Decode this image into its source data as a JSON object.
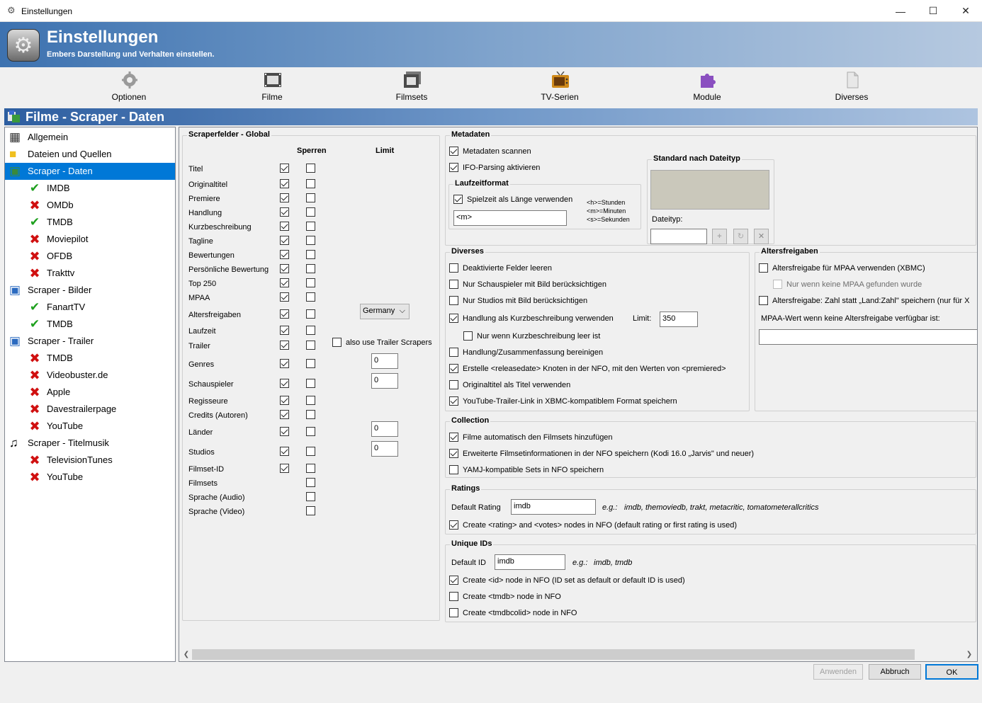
{
  "window": {
    "title": "Einstellungen",
    "minimize": "—",
    "maximize": "☐",
    "close": "✕"
  },
  "header": {
    "title": "Einstellungen",
    "subtitle": "Embers Darstellung und Verhalten einstellen."
  },
  "toolbar": [
    {
      "label": "Optionen",
      "icon": "gear-icon"
    },
    {
      "label": "Filme",
      "icon": "film-icon"
    },
    {
      "label": "Filmsets",
      "icon": "filmsets-icon"
    },
    {
      "label": "TV-Serien",
      "icon": "tv-icon"
    },
    {
      "label": "Module",
      "icon": "puzzle-icon"
    },
    {
      "label": "Diverses",
      "icon": "document-icon"
    }
  ],
  "section": {
    "title": "Filme - Scraper - Daten"
  },
  "tree": [
    {
      "label": "Allgemein",
      "level": 0,
      "icon": "film-icon"
    },
    {
      "label": "Dateien und Quellen",
      "level": 0,
      "icon": "folder-icon"
    },
    {
      "label": "Scraper - Daten",
      "level": 0,
      "icon": "scraper-data-icon",
      "selected": true
    },
    {
      "label": "IMDB",
      "level": 1,
      "icon": "check-icon"
    },
    {
      "label": "OMDb",
      "level": 1,
      "icon": "cross-icon"
    },
    {
      "label": "TMDB",
      "level": 1,
      "icon": "check-icon"
    },
    {
      "label": "Moviepilot",
      "level": 1,
      "icon": "cross-icon"
    },
    {
      "label": "OFDB",
      "level": 1,
      "icon": "cross-icon"
    },
    {
      "label": "Trakttv",
      "level": 1,
      "icon": "cross-icon"
    },
    {
      "label": "Scraper - Bilder",
      "level": 0,
      "icon": "scraper-images-icon"
    },
    {
      "label": "FanartTV",
      "level": 1,
      "icon": "check-icon"
    },
    {
      "label": "TMDB",
      "level": 1,
      "icon": "check-icon"
    },
    {
      "label": "Scraper - Trailer",
      "level": 0,
      "icon": "scraper-trailer-icon"
    },
    {
      "label": "TMDB",
      "level": 1,
      "icon": "cross-icon"
    },
    {
      "label": "Videobuster.de",
      "level": 1,
      "icon": "cross-icon"
    },
    {
      "label": "Apple",
      "level": 1,
      "icon": "cross-icon"
    },
    {
      "label": "Davestrailerpage",
      "level": 1,
      "icon": "cross-icon"
    },
    {
      "label": "YouTube",
      "level": 1,
      "icon": "cross-icon"
    },
    {
      "label": "Scraper - Titelmusik",
      "level": 0,
      "icon": "music-note-icon"
    },
    {
      "label": "TelevisionTunes",
      "level": 1,
      "icon": "cross-icon"
    },
    {
      "label": "YouTube",
      "level": 1,
      "icon": "cross-icon"
    }
  ],
  "scraperfields": {
    "title": "Scraperfelder - Global",
    "col_lock": "Sperren",
    "col_limit": "Limit",
    "rows": [
      {
        "label": "Titel",
        "enabled": true,
        "lock": false
      },
      {
        "label": "Originaltitel",
        "enabled": true,
        "lock": false
      },
      {
        "label": "Premiere",
        "enabled": true,
        "lock": false
      },
      {
        "label": "Handlung",
        "enabled": true,
        "lock": false
      },
      {
        "label": "Kurzbeschreibung",
        "enabled": true,
        "lock": false
      },
      {
        "label": "Tagline",
        "enabled": true,
        "lock": false
      },
      {
        "label": "Bewertungen",
        "enabled": true,
        "lock": false
      },
      {
        "label": "Persönliche Bewertung",
        "enabled": true,
        "lock": false
      },
      {
        "label": "Top 250",
        "enabled": true,
        "lock": false
      },
      {
        "label": "MPAA",
        "enabled": true,
        "lock": false
      },
      {
        "label": "Altersfreigaben",
        "enabled": true,
        "lock": false
      },
      {
        "label": "Laufzeit",
        "enabled": true,
        "lock": false
      },
      {
        "label": "Trailer",
        "enabled": true,
        "lock": false
      },
      {
        "label": "Genres",
        "enabled": true,
        "lock": false
      },
      {
        "label": "Schauspieler",
        "enabled": true,
        "lock": false
      },
      {
        "label": "Regisseure",
        "enabled": true,
        "lock": false
      },
      {
        "label": "Credits (Autoren)",
        "enabled": true,
        "lock": false
      },
      {
        "label": "Länder",
        "enabled": true,
        "lock": false
      },
      {
        "label": "Studios",
        "enabled": true,
        "lock": false
      },
      {
        "label": "Filmset-ID",
        "enabled": true,
        "lock": false
      },
      {
        "label": "Filmsets",
        "enabled": null,
        "lock": false
      },
      {
        "label": "Sprache (Audio)",
        "enabled": null,
        "lock": false
      },
      {
        "label": "Sprache (Video)",
        "enabled": null,
        "lock": false
      }
    ],
    "cert_country": "Germany",
    "trailer_option": "also use Trailer Scrapers",
    "limit_genres": "0",
    "limit_actors": "0",
    "limit_countries": "0",
    "limit_studios": "0"
  },
  "metadata": {
    "title": "Metadaten",
    "scan": "Metadaten scannen",
    "ifo": "IFO-Parsing aktivieren",
    "runtime_title": "Laufzeitformat",
    "runtime_use": "Spielzeit als Länge verwenden",
    "runtime_format": "<m>",
    "legend_h": "<h>=Stunden",
    "legend_m": "<m>=Minuten",
    "legend_s": "<s>=Sekunden",
    "std_title": "Standard nach Dateityp",
    "filetype_label": "Dateityp:",
    "filetype_value": ""
  },
  "diverses": {
    "title": "Diverses",
    "items": [
      {
        "label": "Deaktivierte Felder leeren",
        "checked": false
      },
      {
        "label": "Nur Schauspieler mit Bild berücksichtigen",
        "checked": false
      },
      {
        "label": "Nur Studios mit Bild berücksichtigen",
        "checked": false
      },
      {
        "label": "Handlung als Kurzbeschreibung verwenden",
        "checked": true
      },
      {
        "label": "Nur wenn Kurzbeschreibung leer ist",
        "checked": false
      },
      {
        "label": "Handlung/Zusammenfassung bereinigen",
        "checked": false
      },
      {
        "label": "Erstelle <releasedate> Knoten in der NFO, mit den Werten von <premiered>",
        "checked": true
      },
      {
        "label": "Originaltitel als Titel verwenden",
        "checked": false
      },
      {
        "label": "YouTube-Trailer-Link in XBMC-kompatiblem Format speichern",
        "checked": true
      }
    ],
    "limit_label": "Limit:",
    "limit_value": "350"
  },
  "certifications": {
    "title": "Altersfreigaben",
    "mpaa": "Altersfreigabe für MPAA verwenden (XBMC)",
    "mpaa_only": "Nur wenn keine MPAA gefunden wurde",
    "country": "Altersfreigabe: Zahl statt „Land:Zahl\" speichern (nur für X",
    "fallback_label": "MPAA-Wert wenn keine Altersfreigabe verfügbar ist:",
    "fallback_value": ""
  },
  "collection": {
    "title": "Collection",
    "items": [
      {
        "label": "Filme automatisch den Filmsets hinzufügen",
        "checked": true
      },
      {
        "label": "Erweiterte Filmsetinformationen in der NFO speichern (Kodi 16.0 „Jarvis\" und neuer)",
        "checked": true
      },
      {
        "label": "YAMJ-kompatible Sets in NFO speichern",
        "checked": false
      }
    ]
  },
  "ratings": {
    "title": "Ratings",
    "default_label": "Default Rating",
    "default_value": "imdb",
    "eg": "e.g.:",
    "examples": "imdb, themoviedb, trakt, metacritic, tomatometerallcritics",
    "create": "Create <rating> and <votes> nodes in NFO (default rating or first rating is used)"
  },
  "uniqueids": {
    "title": "Unique IDs",
    "default_label": "Default ID",
    "default_value": "imdb",
    "eg": "e.g.:",
    "examples": "imdb, tmdb",
    "items": [
      {
        "label": "Create <id> node in NFO (ID set as default or default ID is used)",
        "checked": true
      },
      {
        "label": "Create <tmdb> node in NFO",
        "checked": false
      },
      {
        "label": "Create <tmdbcolid> node in NFO",
        "checked": false
      }
    ]
  },
  "footer": {
    "apply": "Anwenden",
    "cancel": "Abbruch",
    "ok": "OK"
  },
  "colors": {
    "selection": "#0078d7",
    "header": "#3d72b0",
    "check": "#1ea01e",
    "cross": "#d01010"
  }
}
